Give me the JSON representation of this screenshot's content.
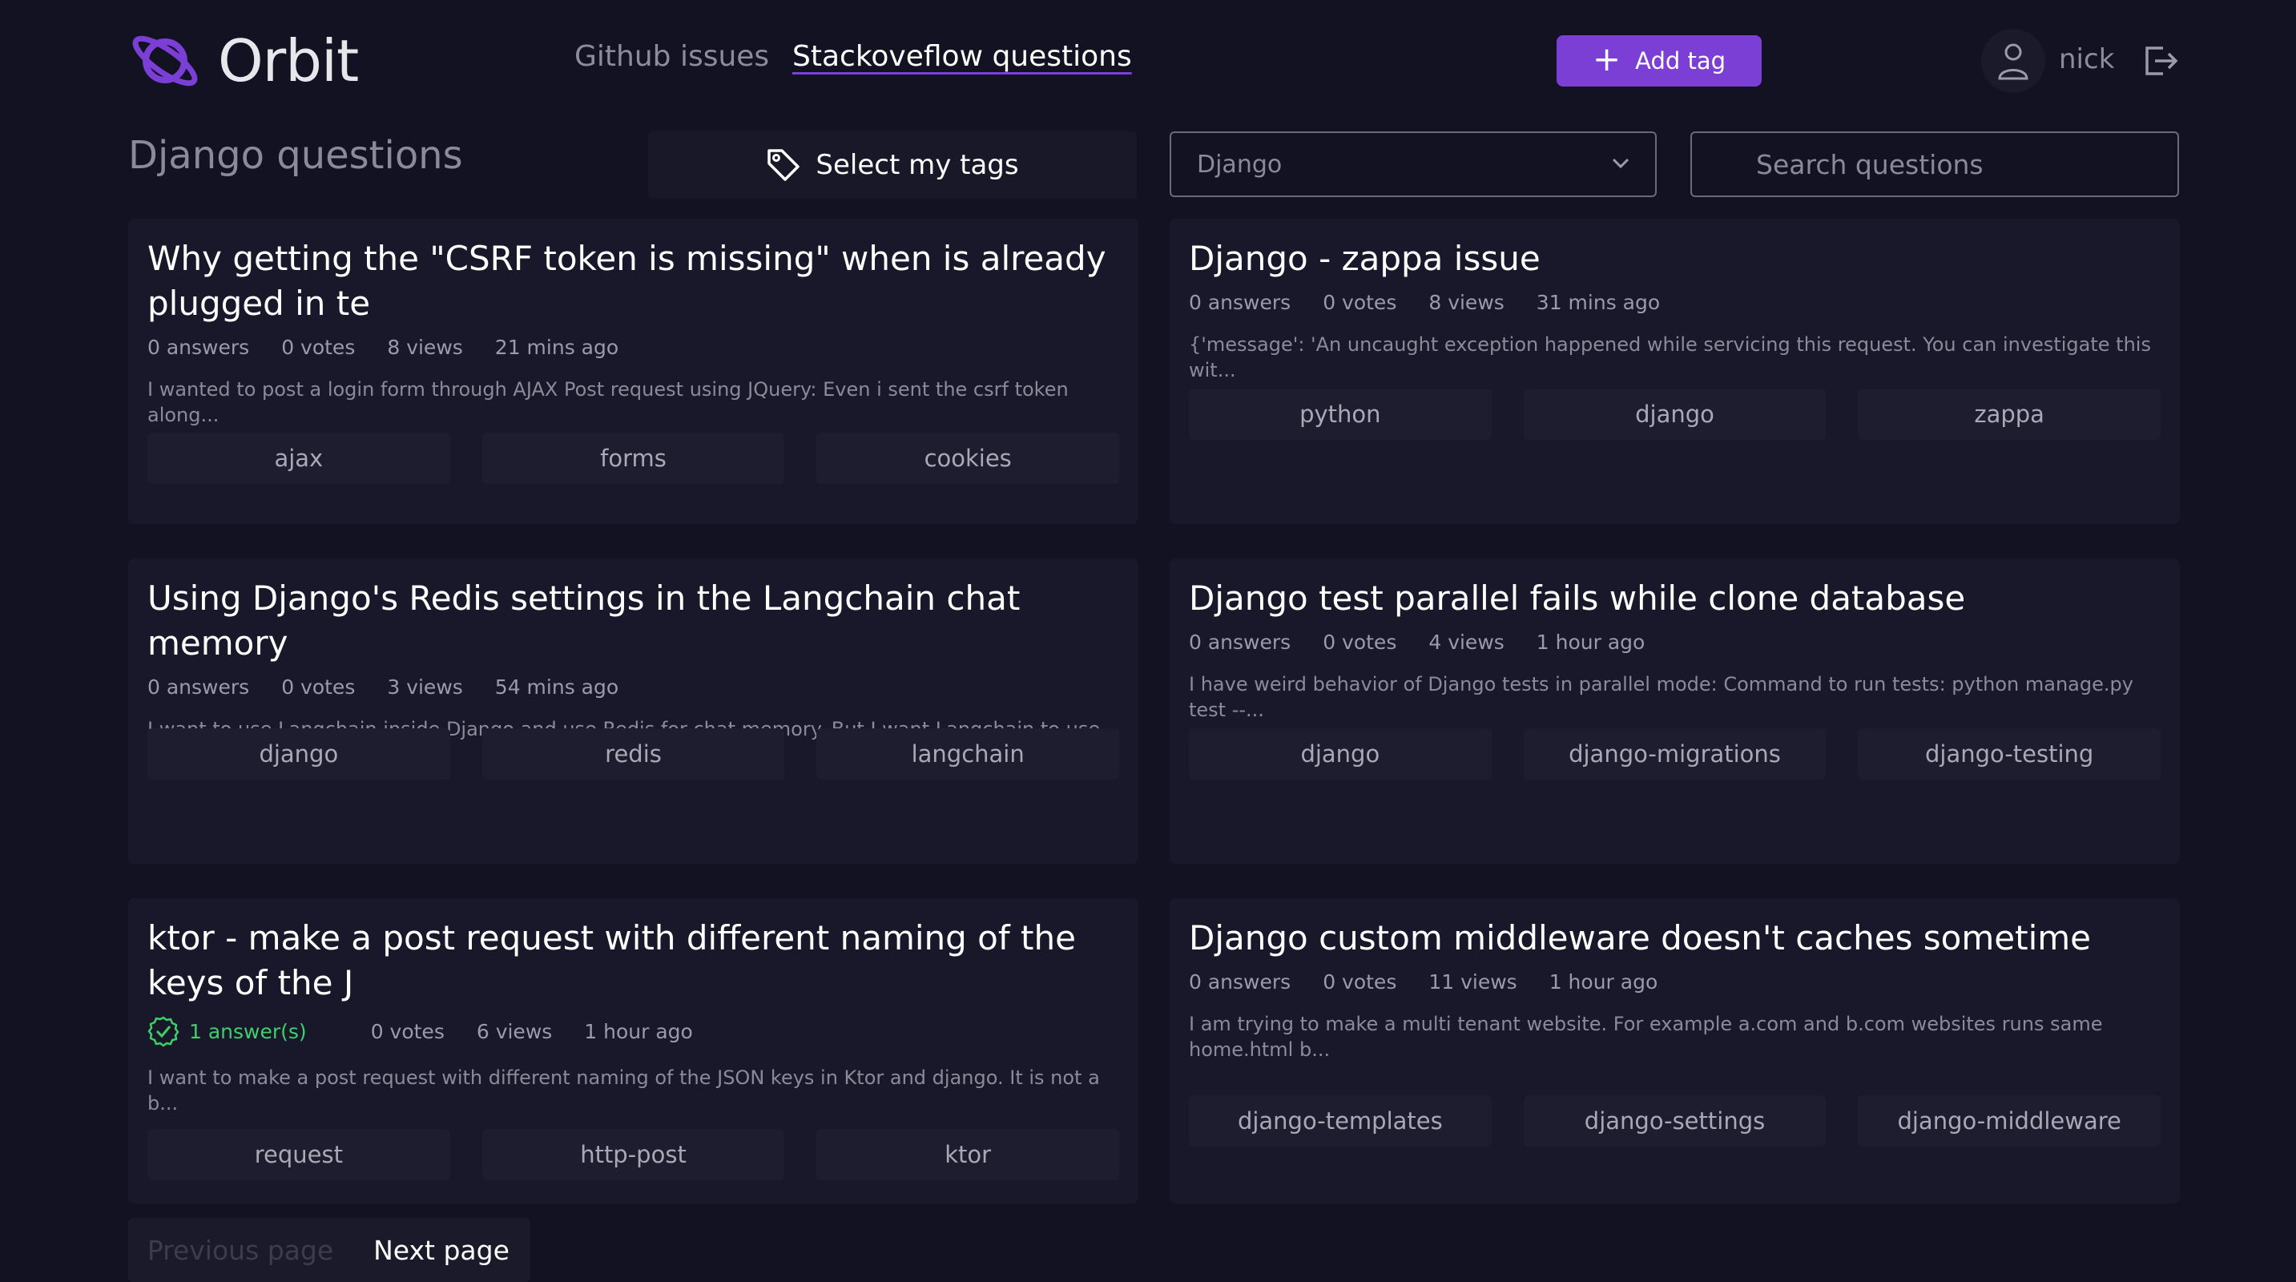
{
  "header": {
    "logo_text": "Orbit",
    "nav": {
      "github": "Github issues",
      "stackoverflow": "Stackoveflow questions"
    },
    "add_tag_label": "Add tag",
    "user_name": "nick"
  },
  "toolbar": {
    "page_title": "Django questions",
    "select_tags_label": "Select my tags",
    "dropdown_value": "Django",
    "search_placeholder": "Search questions"
  },
  "questions": [
    {
      "title": "Why getting the \"CSRF token is missing\" when is already plugged in te",
      "answers": "0 answers",
      "votes": "0 votes",
      "views": "8 views",
      "time": "21 mins ago",
      "excerpt": "I wanted to post a login form through AJAX Post request using JQuery: Even i sent the csrf token along...",
      "tags": [
        "ajax",
        "forms",
        "cookies"
      ]
    },
    {
      "title": "Django - zappa issue",
      "answers": "0 answers",
      "votes": "0 votes",
      "views": "8 views",
      "time": "31 mins ago",
      "excerpt": "{'message': 'An uncaught exception happened while servicing this request. You can investigate this wit...",
      "tags": [
        "python",
        "django",
        "zappa"
      ]
    },
    {
      "title": "Using Django's Redis settings in the Langchain chat memory",
      "answers": "0 answers",
      "votes": "0 votes",
      "views": "3 views",
      "time": "54 mins ago",
      "excerpt": "I want to use Langchain inside Django and use Redis for chat memory. But I want Langchain to use the R...",
      "tags": [
        "django",
        "redis",
        "langchain"
      ]
    },
    {
      "title": "Django test parallel fails while clone database",
      "answers": "0 answers",
      "votes": "0 votes",
      "views": "4 views",
      "time": "1 hour ago",
      "excerpt": "I have weird behavior of Django tests in parallel mode: Command to run tests: python manage.py test --...",
      "tags": [
        "django",
        "django-migrations",
        "django-testing"
      ]
    },
    {
      "title": "ktor - make a post request with different naming of the keys of the J",
      "answers": "1 answer(s)",
      "votes": "0 votes",
      "views": "6 views",
      "time": "1 hour ago",
      "excerpt": "I want to make a post request with different naming of the JSON keys in Ktor and django. It is not a b...",
      "tags": [
        "request",
        "http-post",
        "ktor"
      ]
    },
    {
      "title": "Django custom middleware doesn't caches sometime",
      "answers": "0 answers",
      "votes": "0 votes",
      "views": "11 views",
      "time": "1 hour ago",
      "excerpt": "I am trying to make a multi tenant website. For example a.com and b.com websites runs same home.html b...",
      "tags": [
        "django-templates",
        "django-settings",
        "django-middleware"
      ]
    }
  ],
  "pagination": {
    "previous_label": "Previous page",
    "next_label": "Next page"
  },
  "colors": {
    "background": "#121222",
    "card": "#18182a",
    "accent": "#7b3fd6",
    "answered": "#3ecf6a"
  }
}
